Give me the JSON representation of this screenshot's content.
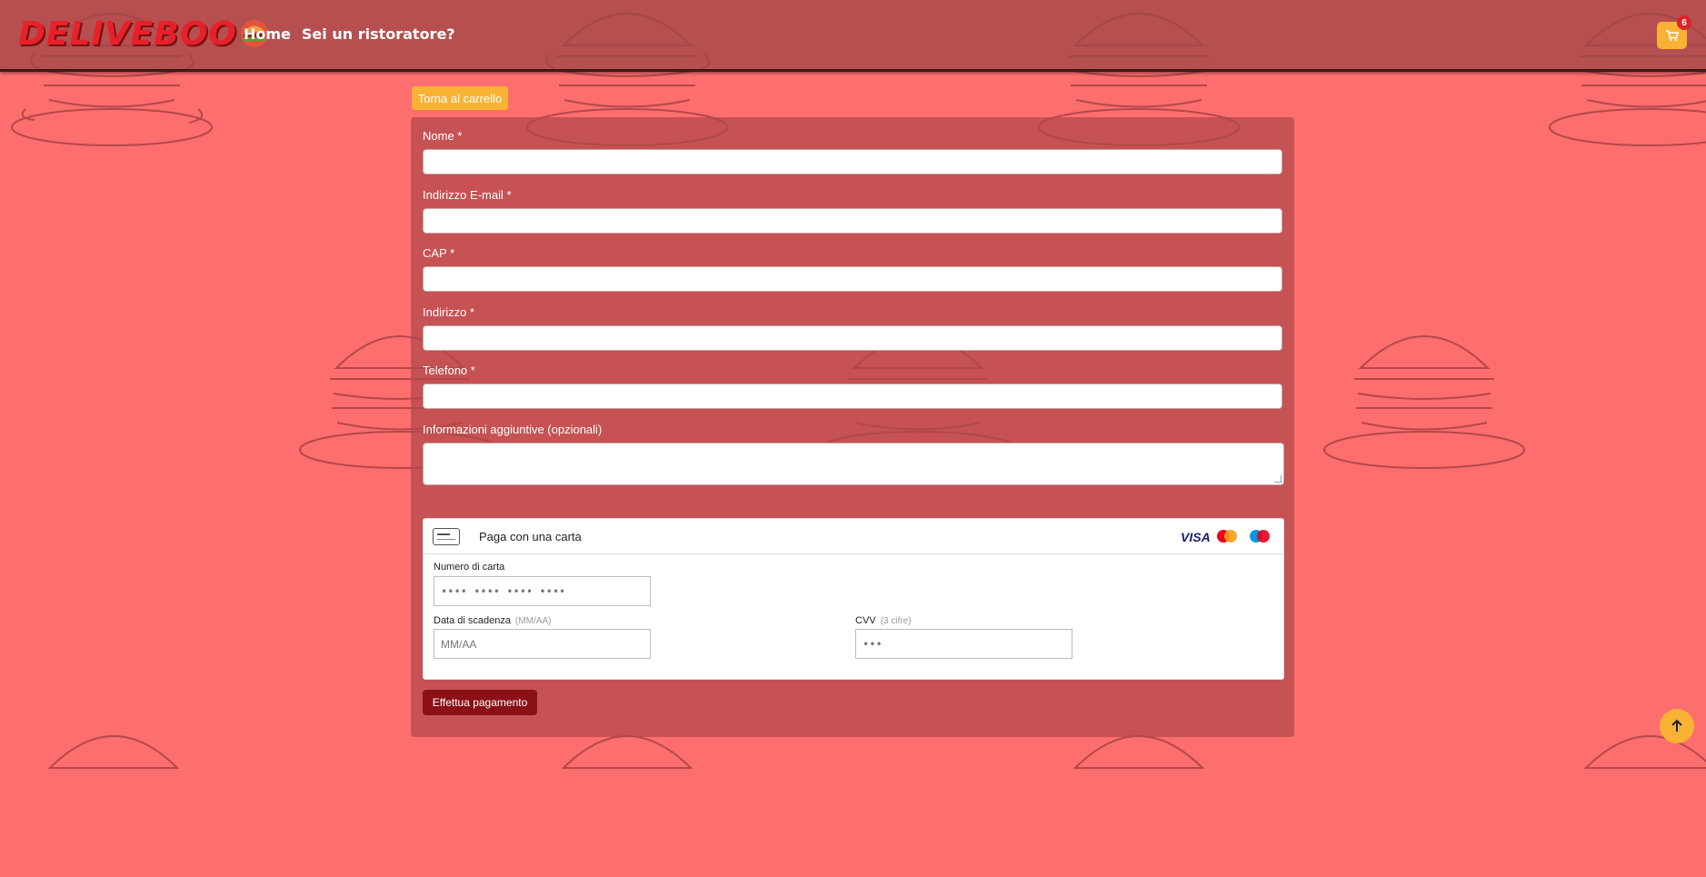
{
  "brand": {
    "logo_text": "DELIVEBOO"
  },
  "nav": {
    "home": "Home",
    "restaurateur": "Sei un ristoratore?"
  },
  "cart": {
    "count": "6",
    "icon": "cart-icon"
  },
  "back_button": "Torna al carrello",
  "form": {
    "name_label": "Nome *",
    "email_label": "Indirizzo E-mail *",
    "cap_label": "CAP *",
    "address_label": "Indirizzo *",
    "phone_label": "Telefono *",
    "notes_label": "Informazioni aggiuntive (opzionali)"
  },
  "payment": {
    "title": "Paga con una carta",
    "brands": {
      "visa": "VISA",
      "mastercard_sub": "mastercard",
      "maestro_sub": "maestro"
    },
    "card_number_label": "Numero di carta",
    "card_number_placeholder": "•••• •••• •••• ••••",
    "expiry_label": "Data di scadenza",
    "expiry_hint": "(MM/AA)",
    "expiry_placeholder": "MM/AA",
    "cvv_label": "CVV",
    "cvv_hint": "(3 cifre)",
    "cvv_placeholder": "•••"
  },
  "submit_button": "Effettua pagamento",
  "colors": {
    "background": "#fd6e6e",
    "header": "#a04648",
    "accent": "#f9b233",
    "submit": "#8a1016",
    "badge": "#d9232d"
  }
}
